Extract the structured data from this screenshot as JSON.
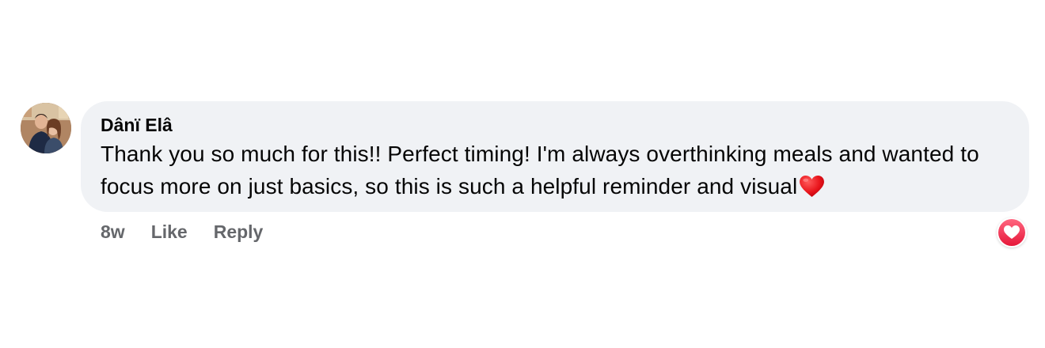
{
  "comment": {
    "author": "Dânï Elâ",
    "text": "Thank you so much for this!! Perfect timing! I'm always overthinking meals and wanted to focus more on just basics, so this is such a helpful reminder and visual",
    "trailing_emoji": "red-heart-emoji",
    "time": "8w",
    "like_label": "Like",
    "reply_label": "Reply",
    "reaction": "love-reaction-icon"
  },
  "colors": {
    "bubble": "#f0f2f5",
    "action_text": "#65676b",
    "love": "#f33e58"
  }
}
